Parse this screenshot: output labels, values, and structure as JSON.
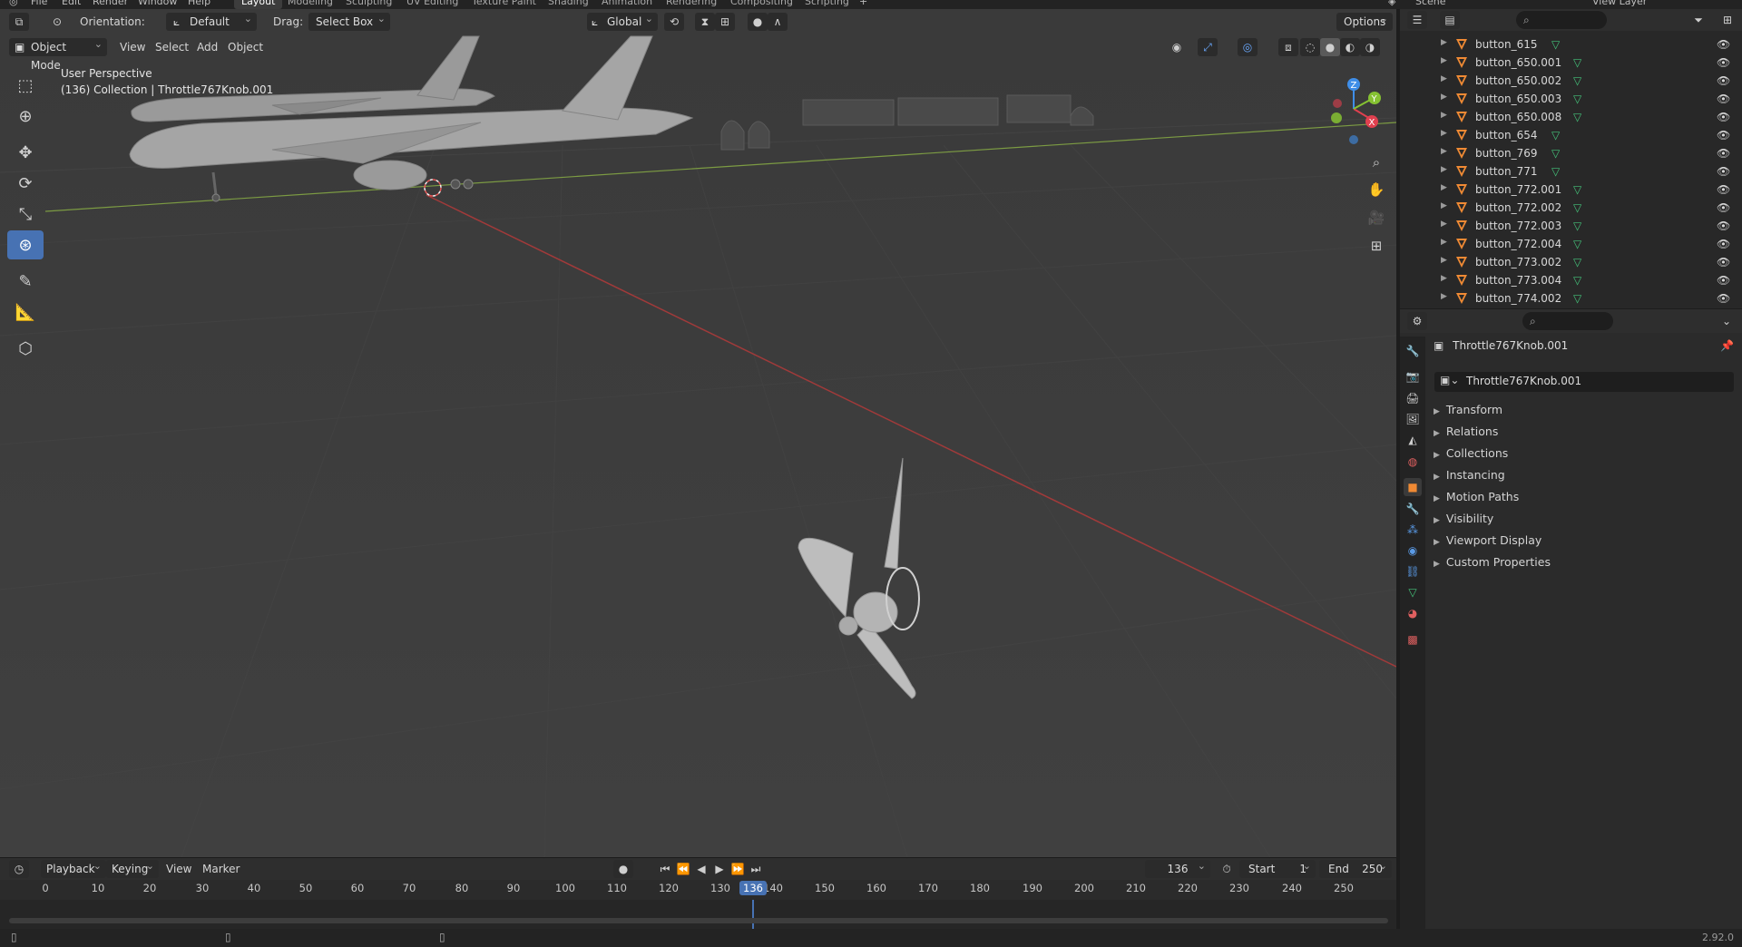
{
  "topbar": {
    "menus": [
      "File",
      "Edit",
      "Render",
      "Window",
      "Help"
    ],
    "workspaces": [
      "Layout",
      "Modeling",
      "Sculpting",
      "UV Editing",
      "Texture Paint",
      "Shading",
      "Animation",
      "Rendering",
      "Compositing",
      "Scripting"
    ],
    "active_workspace": "Layout",
    "add_tab": "+",
    "scene": "Scene",
    "view_layer": "View Layer"
  },
  "viewport_header": {
    "orientation_label": "Orientation:",
    "orientation_value": "Default",
    "drag_label": "Drag:",
    "drag_value": "Select Box",
    "transform_orientation": "Global",
    "options": "Options",
    "mode": "Object Mode",
    "menu_view": "View",
    "menu_select": "Select",
    "menu_add": "Add",
    "menu_object": "Object"
  },
  "viewport": {
    "view_name": "User Perspective",
    "collection_info": "(136) Collection | Throttle767Knob.001",
    "gizmo": {
      "x": "X",
      "y": "Y",
      "z": "Z"
    }
  },
  "outliner": {
    "rows": [
      "button_615",
      "button_650.001",
      "button_650.002",
      "button_650.003",
      "button_650.008",
      "button_654",
      "button_769",
      "button_771",
      "button_772.001",
      "button_772.002",
      "button_772.003",
      "button_772.004",
      "button_773.002",
      "button_773.004",
      "button_774.002"
    ]
  },
  "properties": {
    "object_name": "Throttle767Knob.001",
    "datablock_name": "Throttle767Knob.001",
    "panels": [
      "Transform",
      "Relations",
      "Collections",
      "Instancing",
      "Motion Paths",
      "Visibility",
      "Viewport Display",
      "Custom Properties"
    ]
  },
  "timeline": {
    "menus": [
      "Playback",
      "Keying",
      "View",
      "Marker"
    ],
    "current_frame": "136",
    "start_label": "Start",
    "start_value": "1",
    "end_label": "End",
    "end_value": "250",
    "ruler_ticks": [
      "0",
      "10",
      "20",
      "30",
      "40",
      "50",
      "60",
      "70",
      "80",
      "90",
      "100",
      "110",
      "120",
      "130",
      "140",
      "150",
      "160",
      "170",
      "180",
      "190",
      "200",
      "210",
      "220",
      "230",
      "240",
      "250"
    ]
  },
  "statusbar": {
    "version": "2.92.0"
  },
  "colors": {
    "accent_blue": "#4772b3",
    "object_orange": "#f08a34",
    "mesh_green": "#44c27a",
    "x_axis": "#e0404f",
    "y_axis": "#86c232",
    "z_axis": "#3f8ee8"
  }
}
